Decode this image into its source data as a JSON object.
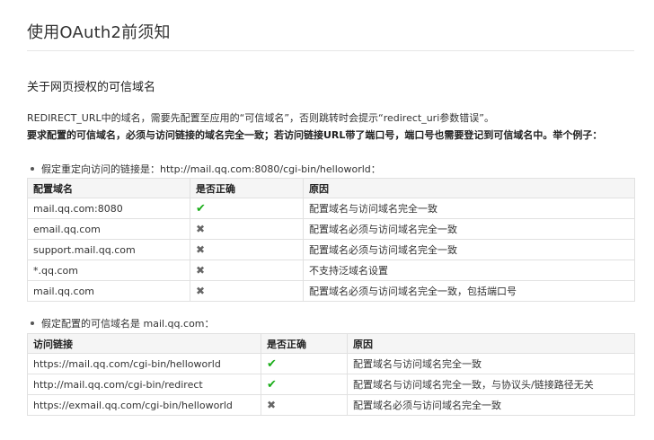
{
  "page": {
    "title": "使用OAuth2前须知",
    "section_title": "关于网页授权的可信域名",
    "para1": "REDIRECT_URL中的域名，需要先配置至应用的“可信域名”，否则跳转时会提示“redirect_uri参数错误”。",
    "para2": "要求配置的可信域名，必须与访问链接的域名完全一致；若访问链接URL带了端口号，端口号也需要登记到可信域名中。举个例子："
  },
  "example1": {
    "bullet": "假定重定向访问的链接是：http://mail.qq.com:8080/cgi-bin/helloworld：",
    "headers": [
      "配置域名",
      "是否正确",
      "原因"
    ],
    "rows": [
      {
        "domain": "mail.qq.com:8080",
        "ok": true,
        "mark": "✔",
        "reason": "配置域名与访问域名完全一致"
      },
      {
        "domain": "email.qq.com",
        "ok": false,
        "mark": "✖",
        "reason": "配置域名必须与访问域名完全一致"
      },
      {
        "domain": "support.mail.qq.com",
        "ok": false,
        "mark": "✖",
        "reason": "配置域名必须与访问域名完全一致"
      },
      {
        "domain": "*.qq.com",
        "ok": false,
        "mark": "✖",
        "reason": "不支持泛域名设置"
      },
      {
        "domain": "mail.qq.com",
        "ok": false,
        "mark": "✖",
        "reason": "配置域名必须与访问域名完全一致，包括端口号"
      }
    ]
  },
  "example2": {
    "bullet": "假定配置的可信域名是 mail.qq.com：",
    "headers": [
      "访问链接",
      "是否正确",
      "原因"
    ],
    "rows": [
      {
        "url": "https://mail.qq.com/cgi-bin/helloworld",
        "ok": true,
        "mark": "✔",
        "reason": "配置域名与访问域名完全一致"
      },
      {
        "url": "http://mail.qq.com/cgi-bin/redirect",
        "ok": true,
        "mark": "✔",
        "reason": "配置域名与访问域名完全一致，与协议头/链接路径无关"
      },
      {
        "url": "https://exmail.qq.com/cgi-bin/helloworld",
        "ok": false,
        "mark": "✖",
        "reason": "配置域名必须与访问域名完全一致"
      }
    ]
  },
  "colors": {
    "check": "#1aad19",
    "cross": "#666666",
    "header_bg": "#f5f5f5",
    "border": "#e1e1e1"
  },
  "icons": {
    "check": "check-icon",
    "cross": "cross-icon"
  }
}
